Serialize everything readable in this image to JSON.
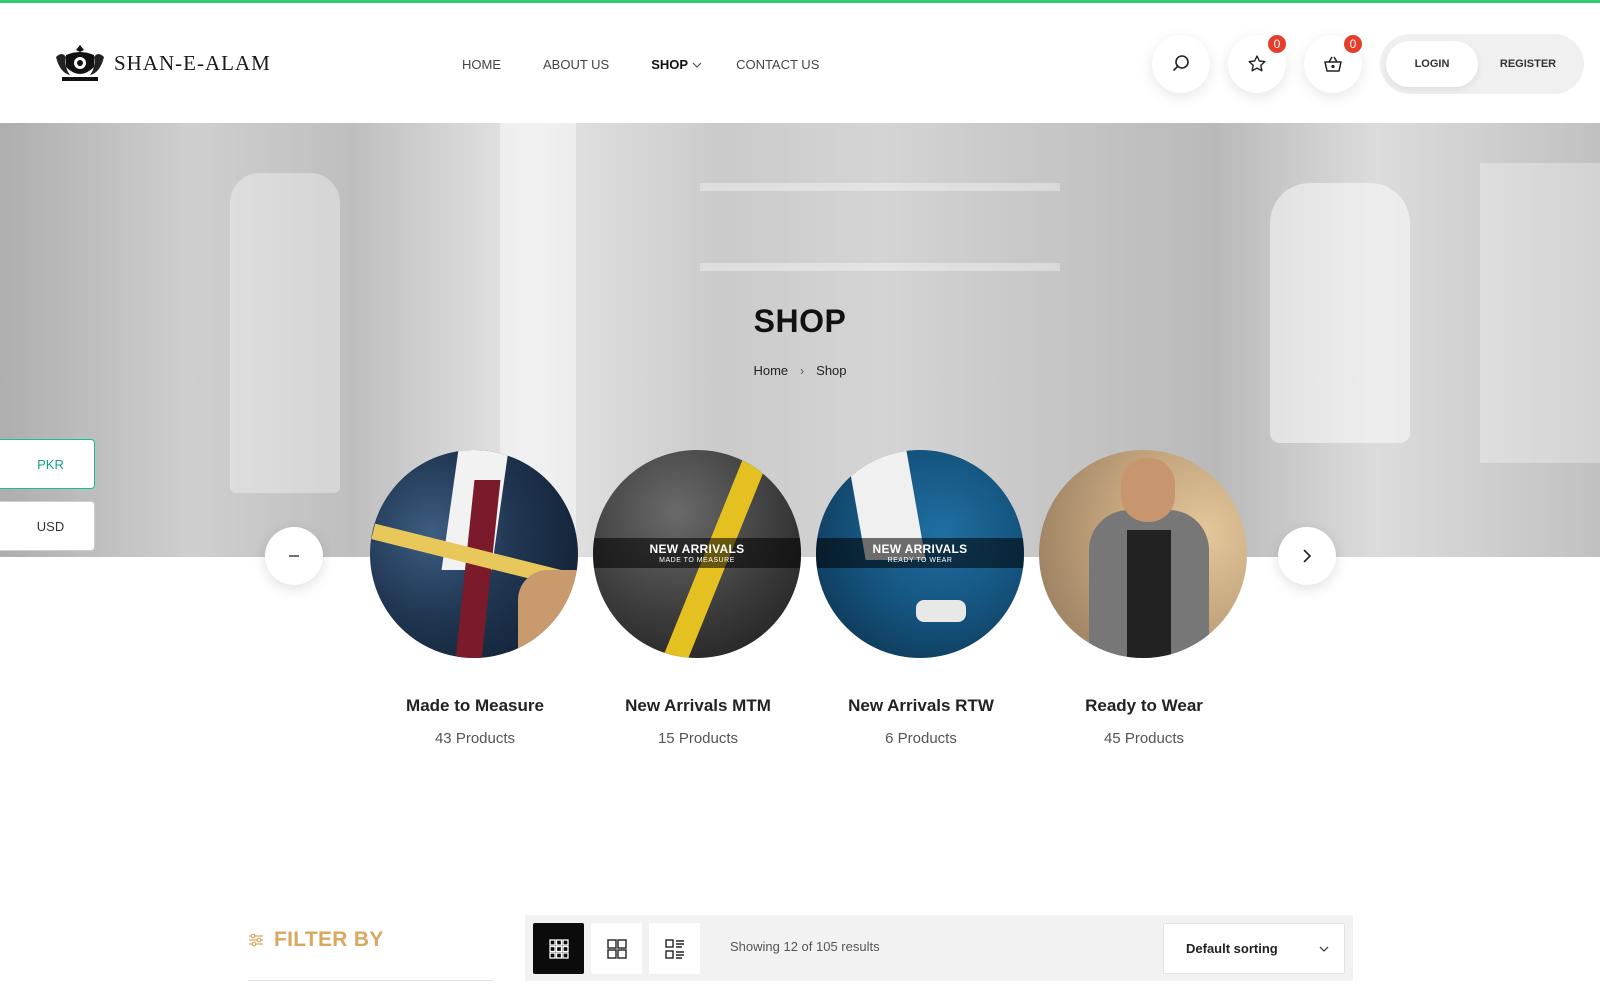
{
  "brand": {
    "name": "SHAN-E-ALAM"
  },
  "nav": {
    "items": [
      {
        "label": "HOME"
      },
      {
        "label": "ABOUT US"
      },
      {
        "label": "SHOP"
      },
      {
        "label": "CONTACT US"
      }
    ]
  },
  "header": {
    "wishlist_count": "0",
    "cart_count": "0",
    "login_label": "LOGIN",
    "register_label": "REGISTER"
  },
  "hero": {
    "title": "SHOP",
    "breadcrumb": [
      "Home",
      "Shop"
    ]
  },
  "currency": {
    "options": [
      "PKR",
      "USD"
    ],
    "selected": "PKR"
  },
  "categories": [
    {
      "name": "Made to Measure",
      "count": "43 Products"
    },
    {
      "name": "New Arrivals MTM",
      "count": "15 Products",
      "band_title": "NEW ARRIVALS",
      "band_sub": "MADE TO MEASURE"
    },
    {
      "name": "New Arrivals RTW",
      "count": "6 Products",
      "band_title": "NEW ARRIVALS",
      "band_sub": "READY TO WEAR"
    },
    {
      "name": "Ready to Wear",
      "count": "45 Products"
    }
  ],
  "shop": {
    "filter_label": "FILTER BY",
    "results_text": "Showing 12 of 105 results",
    "sort_selected": "Default sorting"
  },
  "colors": {
    "accent_top": "#2ecc71",
    "badge": "#e53e2b",
    "filter": "#d9a760",
    "currency_active": "#1abc9c"
  }
}
